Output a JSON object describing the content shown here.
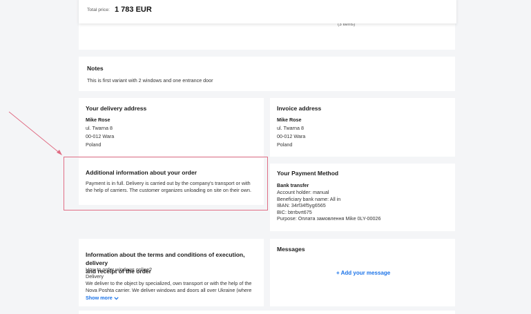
{
  "summary": {
    "total_label": "Total price:",
    "total_value": "1 783 EUR",
    "items_count": "(3 items)"
  },
  "notes": {
    "title": "Notes",
    "text": "This is first variant with 2 windows and one entrance door"
  },
  "delivery": {
    "title": "Your delivery address",
    "name": "Mike Rose",
    "street": "ul. Twarna 8",
    "city": "00-012 Wara",
    "country": "Poland"
  },
  "invoice": {
    "title": "Invoice address",
    "name": "Mike Rose",
    "street": "ul. Twarna 8",
    "city": "00-012 Wara",
    "country": "Poland"
  },
  "additional": {
    "title": "Additional information about your order",
    "line1": "Payment is in full. Delivery is carried out by the company's transport or with",
    "line2": "the help of carriers. The customer organizes unloading on site on their own."
  },
  "payment": {
    "title": "Your Payment Method",
    "method": "Bank transfer",
    "holder": "Account holder: manual",
    "bank": "Beneficiary bank name: All in",
    "iban": "IBAN: 34rf34f5yg6565",
    "bic": "BIC: btrrbvrt675",
    "purpose": "Purpose: Оплата замовлення Mike 0LY-00026"
  },
  "terms": {
    "title_line1": "Information about the terms and conditions of execution, delivery",
    "title_line2": "and receipt of the order",
    "q1": "How to order windows online?",
    "q2": "Delivery",
    "body1": "We deliver to the object by specialized, own transport or with the help of the",
    "body2": "Nova Poshta carrier. We deliver windows and doors all over Ukraine (where",
    "show_more": "Show more"
  },
  "messages": {
    "title": "Messages",
    "add_label": "+ Add your message"
  },
  "colors": {
    "accent": "#1b73e8",
    "highlight": "#e06d84"
  }
}
